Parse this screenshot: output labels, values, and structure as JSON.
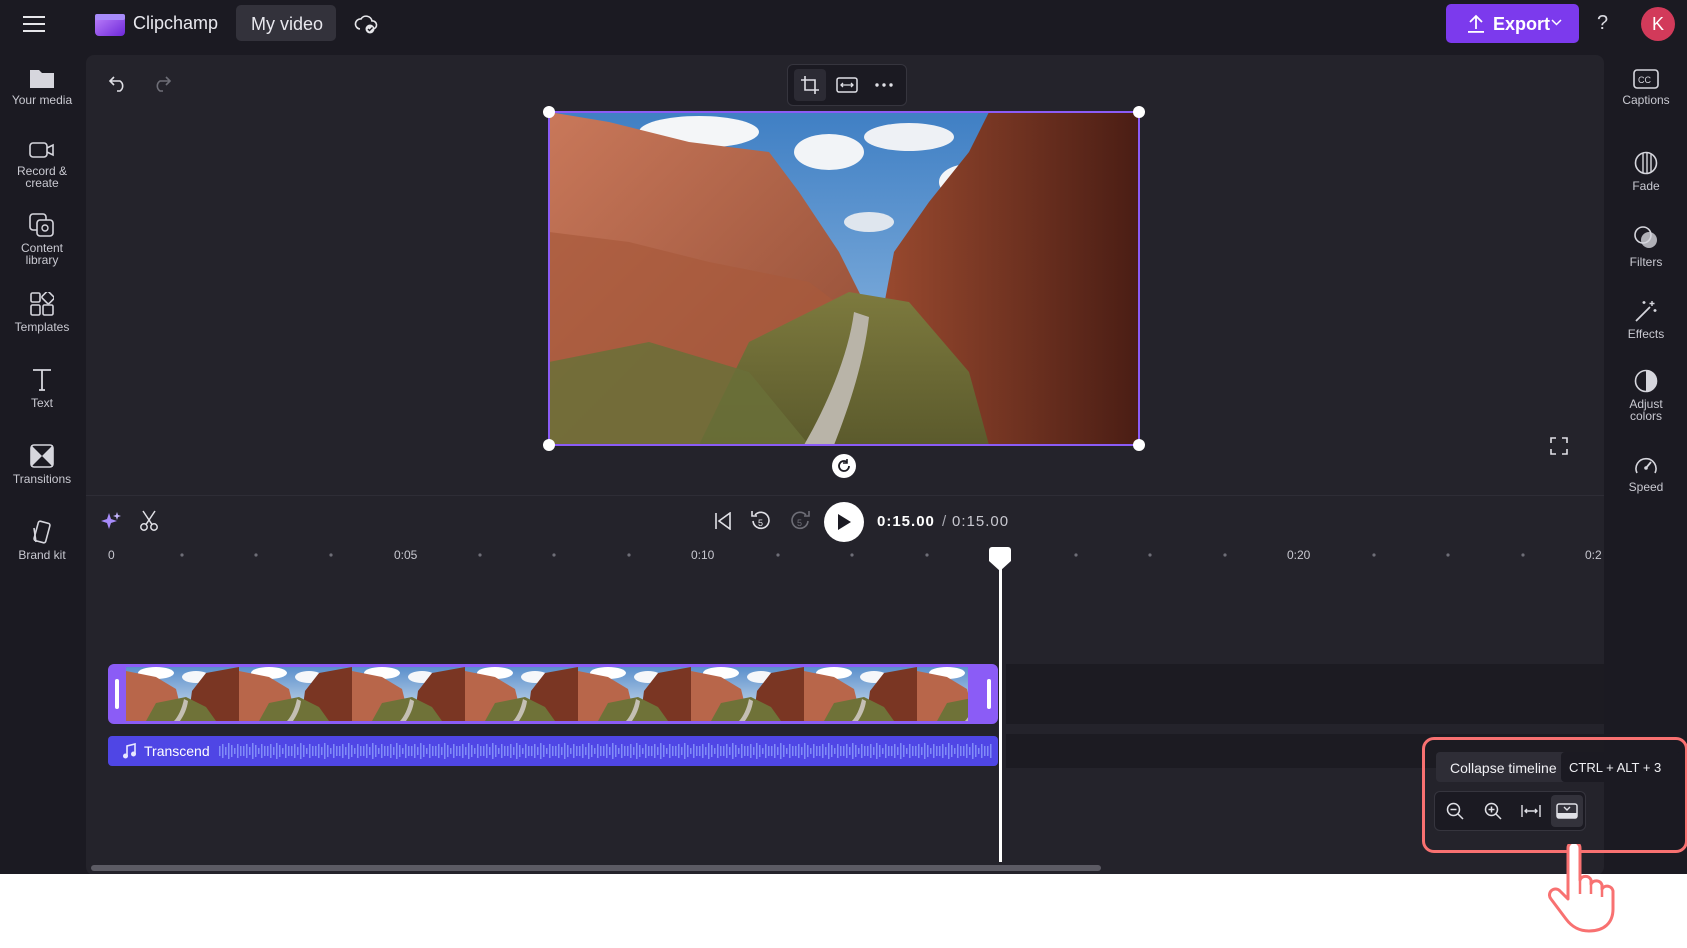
{
  "app": {
    "name": "Clipchamp",
    "project_title": "My video",
    "user_initial": "K"
  },
  "topbar": {
    "export_label": "Export",
    "help_label": "?"
  },
  "left_nav": [
    {
      "label": "Your media",
      "icon": "folder-icon"
    },
    {
      "label": "Record &\ncreate",
      "icon": "camera-icon"
    },
    {
      "label": "Content\nlibrary",
      "icon": "library-icon"
    },
    {
      "label": "Templates",
      "icon": "templates-icon"
    },
    {
      "label": "Text",
      "icon": "text-icon"
    },
    {
      "label": "Transitions",
      "icon": "transitions-icon"
    },
    {
      "label": "Brand kit",
      "icon": "brand-kit-icon"
    }
  ],
  "right_nav": [
    {
      "label": "Captions",
      "icon": "captions-icon"
    },
    {
      "label": "Fade",
      "icon": "fade-icon"
    },
    {
      "label": "Filters",
      "icon": "filters-icon"
    },
    {
      "label": "Effects",
      "icon": "effects-icon"
    },
    {
      "label": "Adjust\ncolors",
      "icon": "adjust-colors-icon"
    },
    {
      "label": "Speed",
      "icon": "speed-icon"
    }
  ],
  "player": {
    "current_time": "0:15.00",
    "separator": "/",
    "total_time": "0:15.00",
    "skip_seconds": "5"
  },
  "ruler": {
    "labels": [
      "0",
      "0:05",
      "0:10",
      "0:20",
      "0:2"
    ]
  },
  "tracks": {
    "audio_label": "Transcend"
  },
  "tooltip": {
    "text": "Collapse timeline",
    "shortcut": "CTRL + ALT + 3"
  },
  "colors": {
    "accent": "#7c3aed",
    "clip_border": "#8b5cf6",
    "audio": "#4f46e5",
    "highlight": "#f87171",
    "background": "#1b1a22"
  }
}
